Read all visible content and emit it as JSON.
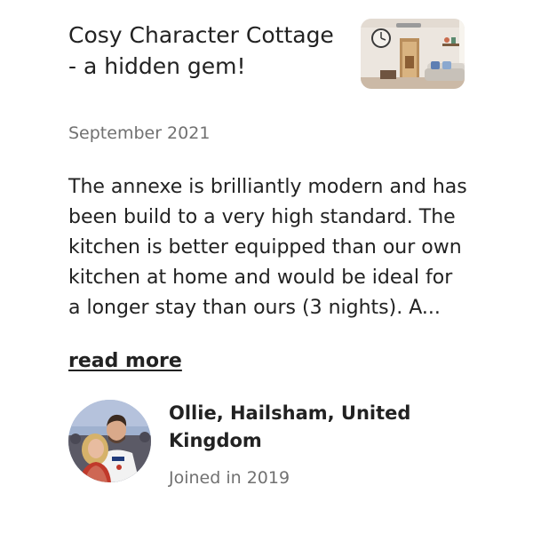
{
  "review": {
    "title": "Cosy Character Cottage - a hidden gem!",
    "date": "September 2021",
    "body": "The annexe is brilliantly modern and has been build to a very high standard. The kitchen is better equipped than our own kitchen at home and would be ideal for a longer stay than ours (3 nights). A...",
    "read_more_label": "read more"
  },
  "reviewer": {
    "name": "Ollie, Hailsham, United Kingdom",
    "joined": "Joined in 2019"
  },
  "icons": {
    "thumbnail": "listing-photo",
    "avatar": "reviewer-photo"
  }
}
